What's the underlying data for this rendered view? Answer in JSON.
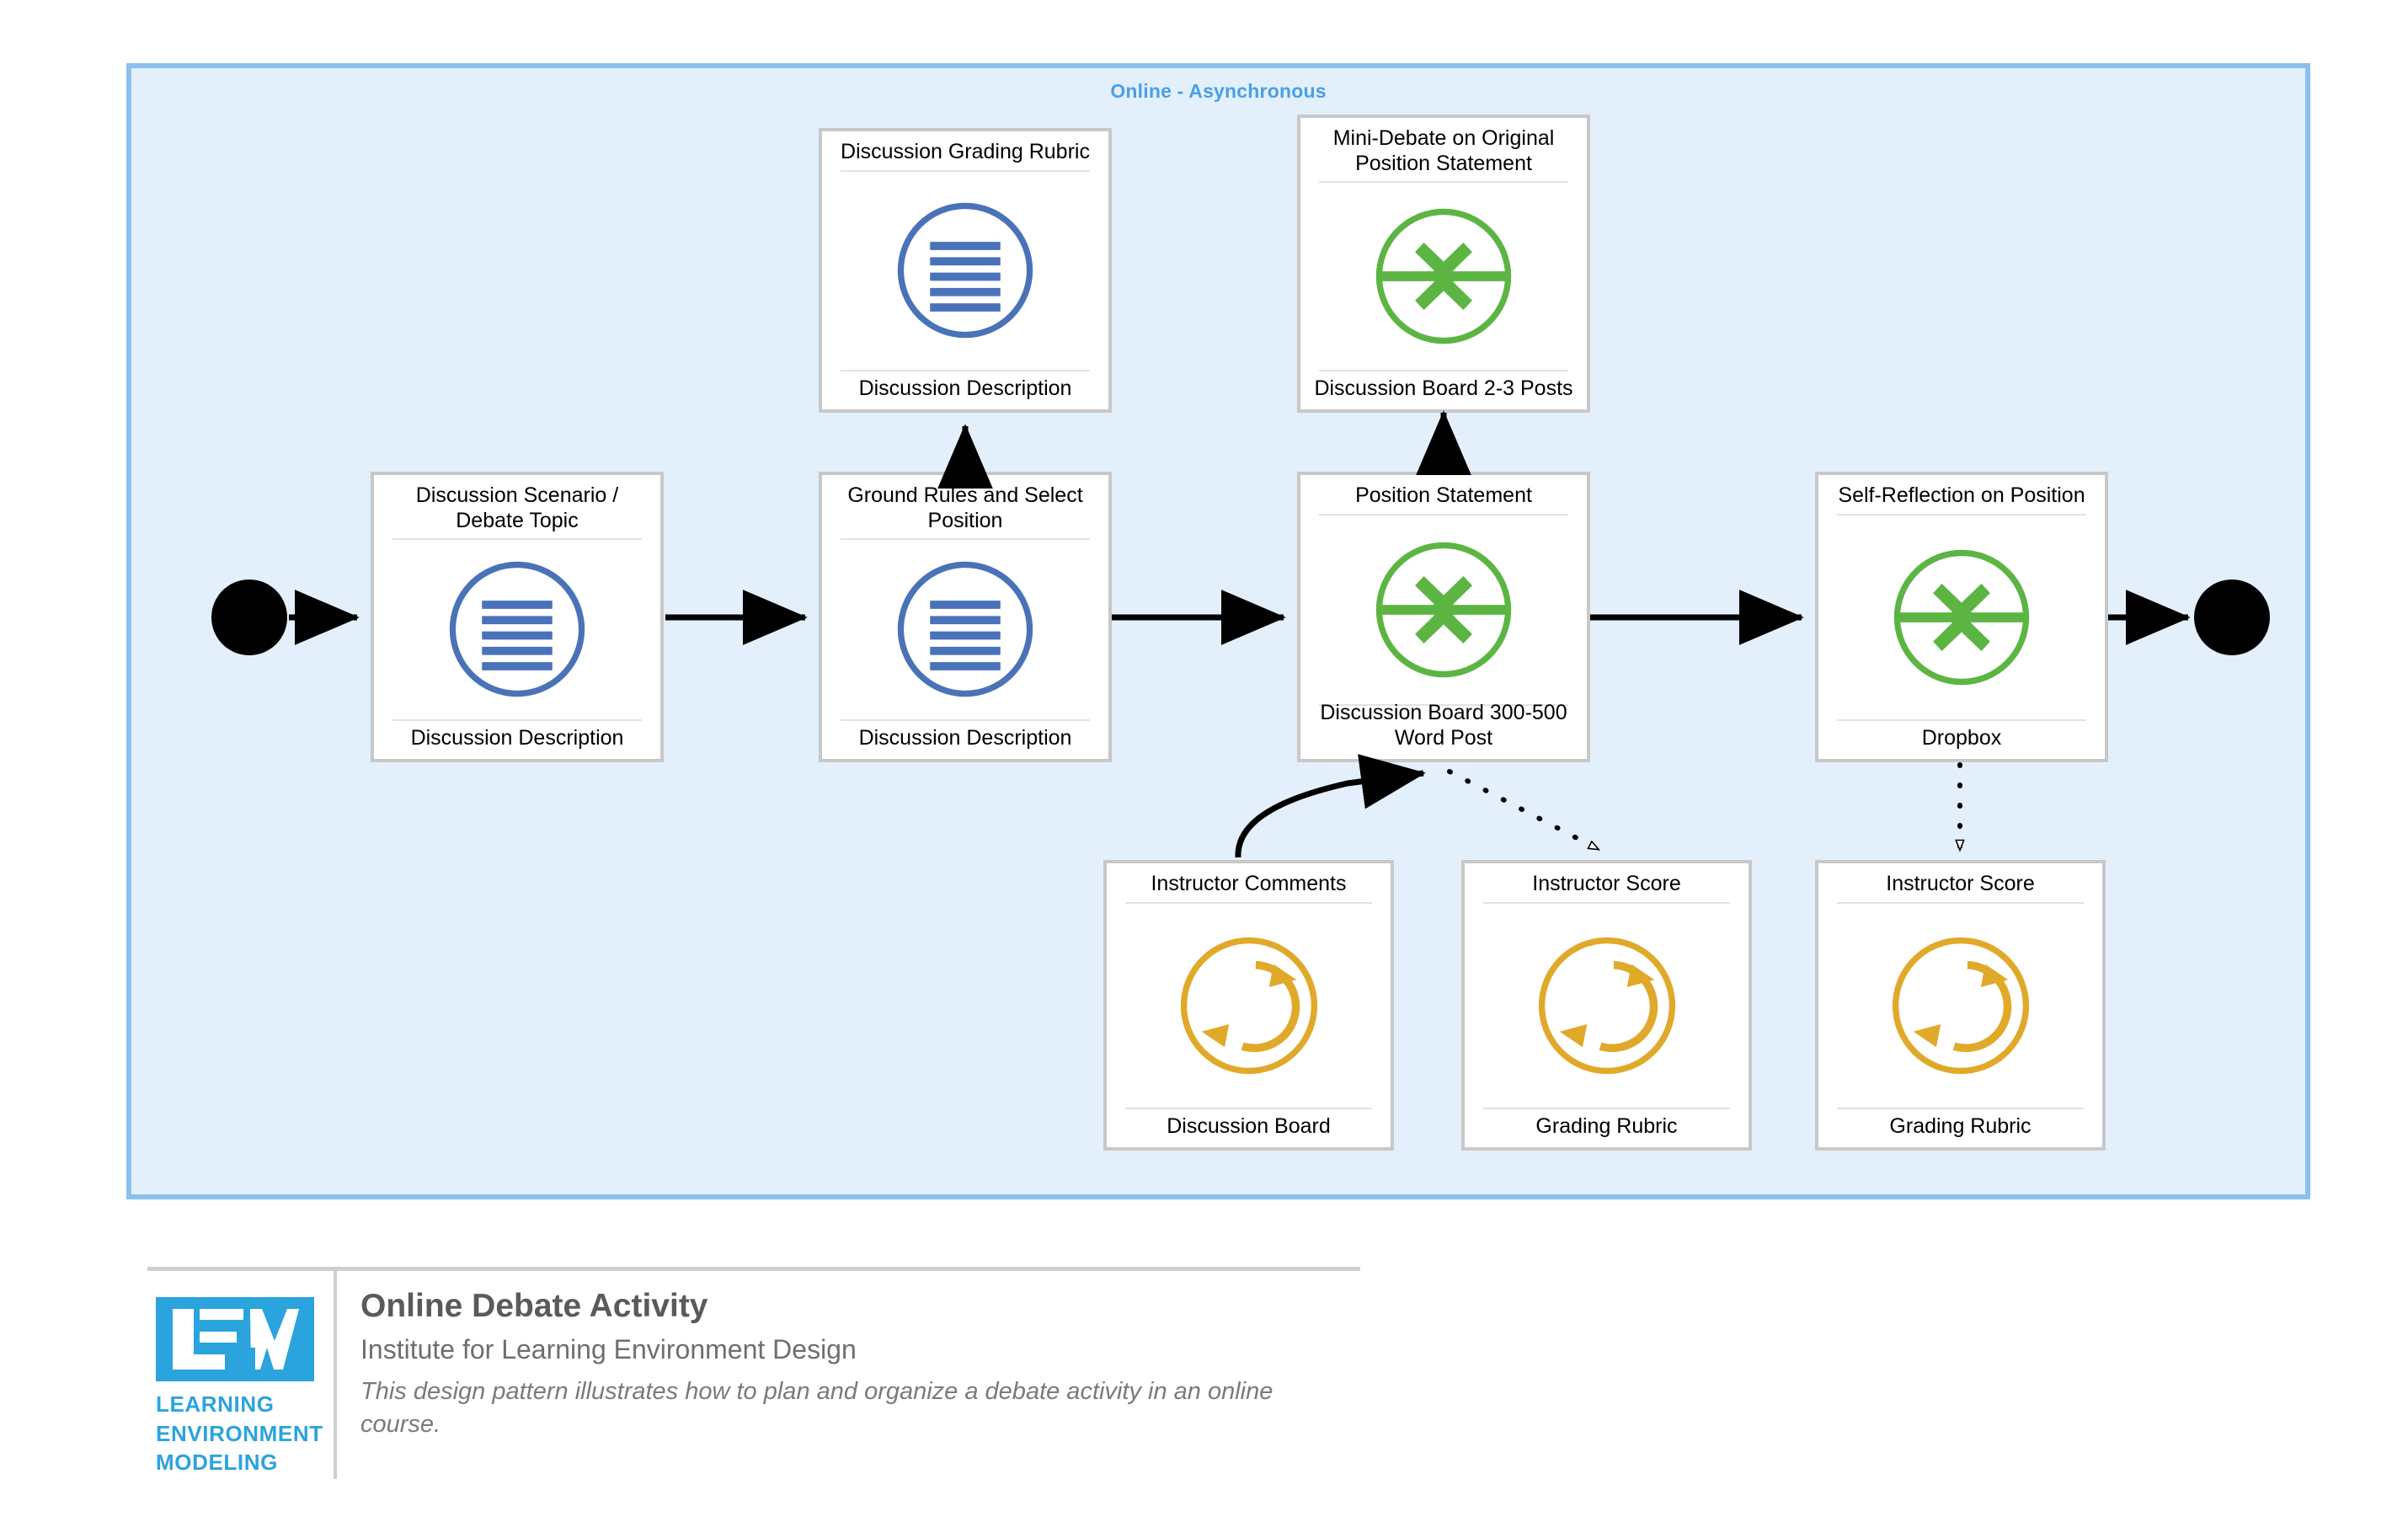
{
  "environment": {
    "label": "Online - Asynchronous",
    "accent_color": "#4a9ee8",
    "fill_color": "#e3f0fb",
    "border_color": "#8cc0ef"
  },
  "legend_colors": {
    "content_blue": "#4a72b8",
    "practice_green": "#5cb543",
    "feedback_orange": "#e0a92a",
    "connector_black": "#000000",
    "card_border": "#c8c8c8"
  },
  "nodes": [
    {
      "id": "start",
      "type": "start-node",
      "shape": "filled-circle"
    },
    {
      "id": "discussion-scenario",
      "type": "content",
      "icon": "content-lines-icon",
      "title": "Discussion Scenario / Debate Topic",
      "footer": "Discussion Description"
    },
    {
      "id": "discussion-grading-rubric",
      "type": "content",
      "icon": "content-lines-icon",
      "title": "Discussion Grading Rubric",
      "footer": "Discussion Description"
    },
    {
      "id": "ground-rules",
      "type": "content",
      "icon": "content-lines-icon",
      "title": "Ground Rules and Select Position",
      "footer": "Discussion Description"
    },
    {
      "id": "mini-debate",
      "type": "practice",
      "icon": "converging-arrows-icon",
      "title": "Mini-Debate on Original Position Statement",
      "footer": "Discussion Board 2-3 Posts"
    },
    {
      "id": "position-statement",
      "type": "practice",
      "icon": "converging-arrows-icon",
      "title": "Position Statement",
      "footer": "Discussion Board 300-500 Word Post"
    },
    {
      "id": "self-reflection",
      "type": "practice",
      "icon": "converging-arrows-icon",
      "title": "Self-Reflection on Position",
      "footer": "Dropbox"
    },
    {
      "id": "instructor-comments",
      "type": "feedback",
      "icon": "feedback-loop-icon",
      "title": "Instructor Comments",
      "footer": "Discussion Board"
    },
    {
      "id": "instructor-score-post",
      "type": "feedback",
      "icon": "feedback-loop-icon",
      "title": "Instructor Score",
      "footer": "Grading Rubric"
    },
    {
      "id": "instructor-score-reflection",
      "type": "feedback",
      "icon": "feedback-loop-icon",
      "title": "Instructor Score",
      "footer": "Grading Rubric"
    },
    {
      "id": "end",
      "type": "end-node",
      "shape": "filled-circle"
    }
  ],
  "connections": [
    {
      "from": "start",
      "to": "discussion-scenario",
      "style": "solid",
      "arrow": "filled"
    },
    {
      "from": "discussion-scenario",
      "to": "ground-rules",
      "style": "solid",
      "arrow": "filled"
    },
    {
      "from": "ground-rules",
      "to": "discussion-grading-rubric",
      "style": "solid",
      "arrow": "filled"
    },
    {
      "from": "ground-rules",
      "to": "position-statement",
      "style": "solid",
      "arrow": "filled"
    },
    {
      "from": "position-statement",
      "to": "mini-debate",
      "style": "solid",
      "arrow": "filled"
    },
    {
      "from": "position-statement",
      "to": "self-reflection",
      "style": "solid",
      "arrow": "filled"
    },
    {
      "from": "self-reflection",
      "to": "end",
      "style": "solid",
      "arrow": "filled"
    },
    {
      "from": "instructor-comments",
      "to": "position-statement",
      "style": "solid-curved",
      "arrow": "filled"
    },
    {
      "from": "position-statement",
      "to": "instructor-score-post",
      "style": "dotted",
      "arrow": "open"
    },
    {
      "from": "self-reflection",
      "to": "instructor-score-reflection",
      "style": "dotted",
      "arrow": "open"
    }
  ],
  "footer": {
    "logo": {
      "mark_text": "LEM",
      "words": [
        "LEARNING",
        "ENVIRONMENT",
        "MODELING"
      ],
      "color": "#2ba3dd"
    },
    "title": "Online Debate Activity",
    "subtitle": "Institute for Learning Environment Design",
    "description": "This design pattern illustrates how to plan and organize a debate activity in an online course."
  }
}
